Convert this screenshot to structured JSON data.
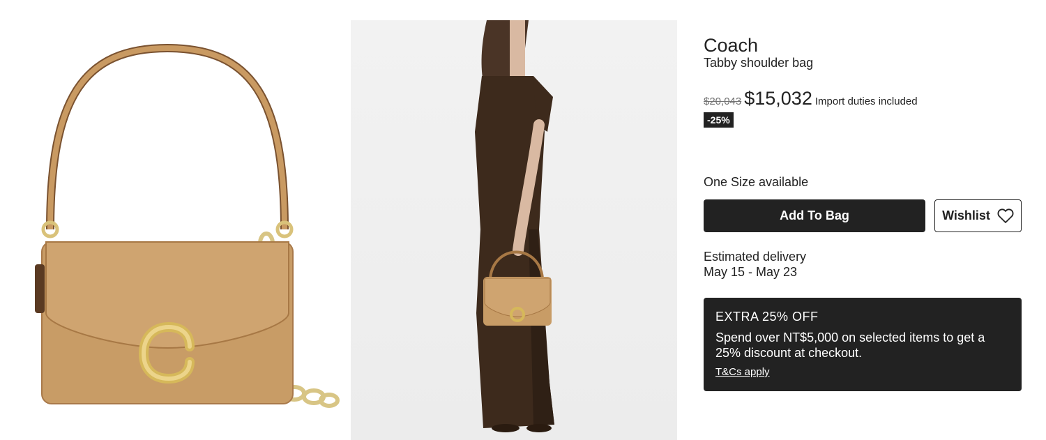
{
  "product": {
    "brand": "Coach",
    "name": "Tabby shoulder bag"
  },
  "pricing": {
    "original_price": "$20,043",
    "sale_price": "$15,032",
    "duties_note": "Import duties included",
    "discount_badge": "-25%"
  },
  "size": {
    "availability": "One Size available"
  },
  "actions": {
    "add_to_bag_label": "Add To Bag",
    "wishlist_label": "Wishlist"
  },
  "delivery": {
    "label": "Estimated delivery",
    "dates": "May 15 - May 23"
  },
  "promo": {
    "title": "EXTRA 25% OFF",
    "text": "Spend over NT$5,000 on selected items to get a 25% discount at checkout.",
    "link_label": "T&Cs apply"
  },
  "icons": {
    "wishlist": "heart-outline-icon"
  },
  "colors": {
    "primary": "#222222",
    "muted": "#727272",
    "background": "#ffffff",
    "bag_tan": "#c89c66"
  }
}
